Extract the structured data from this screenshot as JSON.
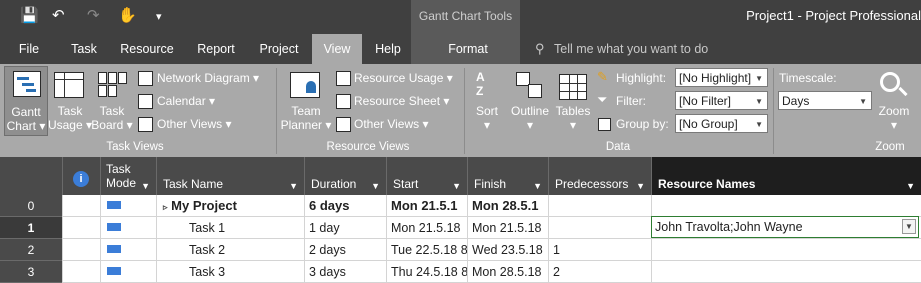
{
  "app": {
    "title": "Project1  -  Project Professional",
    "context_group": "Gantt Chart Tools"
  },
  "qat": {
    "save": "💾",
    "undo": "↶",
    "redo": "↷",
    "touch": "✋",
    "customize": "▾"
  },
  "tabs": [
    {
      "label": "File"
    },
    {
      "label": "Task"
    },
    {
      "label": "Resource"
    },
    {
      "label": "Report"
    },
    {
      "label": "Project"
    },
    {
      "label": "View"
    },
    {
      "label": "Help"
    },
    {
      "label": "Format"
    }
  ],
  "tell_me": "Tell me what you want to do",
  "ribbon": {
    "task_views": {
      "group_label": "Task Views",
      "gantt": [
        "Gantt",
        "Chart ▾"
      ],
      "task_usage": [
        "Task",
        "Usage ▾"
      ],
      "task_board": [
        "Task",
        "Board ▾"
      ],
      "network": "Network Diagram ▾",
      "calendar": "Calendar ▾",
      "other": "Other Views ▾"
    },
    "resource_views": {
      "group_label": "Resource Views",
      "team_planner": [
        "Team",
        "Planner ▾"
      ],
      "resource_usage": "Resource Usage ▾",
      "resource_sheet": "Resource Sheet ▾",
      "other": "Other Views ▾"
    },
    "data": {
      "group_label": "Data",
      "sort": [
        "Sort",
        "▾"
      ],
      "outline": [
        "Outline",
        "▾"
      ],
      "tables": [
        "Tables",
        "▾"
      ],
      "highlight_label": "Highlight:",
      "highlight_value": "[No Highlight]",
      "filter_label": "Filter:",
      "filter_value": "[No Filter]",
      "groupby_label": "Group by:",
      "groupby_value": "[No Group]"
    },
    "zoom": {
      "group_label": "Zoom",
      "timescale_label": "Timescale:",
      "timescale_value": "Days",
      "zoom": [
        "Zoom",
        "▾"
      ]
    }
  },
  "grid": {
    "headers": {
      "info": "i",
      "task_mode": [
        "Task",
        "Mode"
      ],
      "task_name": "Task Name",
      "duration": "Duration",
      "start": "Start",
      "finish": "Finish",
      "predecessors": "Predecessors",
      "resource_names": "Resource Names"
    },
    "rows": [
      {
        "id": "0",
        "name": "My Project",
        "duration": "6 days",
        "start": "Mon 21.5.1",
        "finish": "Mon 28.5.1",
        "pred": "",
        "res": "",
        "summary": true
      },
      {
        "id": "1",
        "name": "Task 1",
        "duration": "1 day",
        "start": "Mon 21.5.18",
        "finish": "Mon 21.5.18",
        "pred": "",
        "res": "John Travolta;John Wayne"
      },
      {
        "id": "2",
        "name": "Task 2",
        "duration": "2 days",
        "start": "Tue 22.5.18 8",
        "finish": "Wed 23.5.18",
        "pred": "1",
        "res": ""
      },
      {
        "id": "3",
        "name": "Task 3",
        "duration": "3 days",
        "start": "Thu 24.5.18 8",
        "finish": "Mon 28.5.18",
        "pred": "2",
        "res": ""
      }
    ],
    "summary_toggle": "▹"
  }
}
